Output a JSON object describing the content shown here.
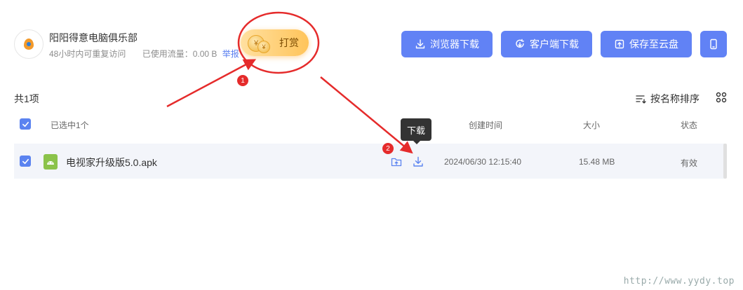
{
  "share": {
    "owner_name": "阳阳得意电脑俱乐部",
    "visit_info": "48小时内可重复访问",
    "traffic_info": "已使用流量：0.00 B",
    "report_label": "举报",
    "reward_label": "打赏",
    "coin_symbol": "¥"
  },
  "toolbar": {
    "browser_download": "浏览器下载",
    "client_download": "客户端下载",
    "save_to_cloud": "保存至云盘"
  },
  "list": {
    "count_label": "共1项",
    "sort_label": "按名称排序",
    "header": {
      "selected": "已选中1个",
      "created": "创建时间",
      "size": "大小",
      "status": "状态"
    },
    "files": [
      {
        "name": "电视家升级版5.0.apk",
        "created": "2024/06/30 12:15:40",
        "size": "15.48 MB",
        "status": "有效"
      }
    ],
    "tooltip": "下载"
  },
  "annotations": {
    "marker_1": "1",
    "marker_2": "2",
    "color": "#e52b2b"
  },
  "watermark": "http://www.yydy.top",
  "colors": {
    "accent": "#6182f5",
    "row_bg": "#f3f5fa",
    "reward": "#ffc45a"
  }
}
